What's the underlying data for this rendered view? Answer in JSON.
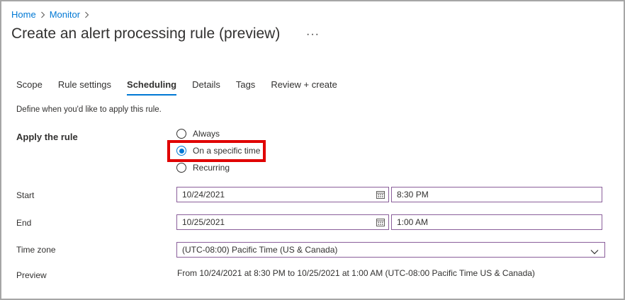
{
  "breadcrumb": {
    "items": [
      "Home",
      "Monitor"
    ]
  },
  "header": {
    "title": "Create an alert processing rule (preview)",
    "more_label": "···"
  },
  "tabs": [
    {
      "label": "Scope",
      "active": false
    },
    {
      "label": "Rule settings",
      "active": false
    },
    {
      "label": "Scheduling",
      "active": true
    },
    {
      "label": "Details",
      "active": false
    },
    {
      "label": "Tags",
      "active": false
    },
    {
      "label": "Review + create",
      "active": false
    }
  ],
  "scheduling": {
    "description": "Define when you'd like to apply this rule.",
    "apply_label": "Apply the rule",
    "options": [
      {
        "label": "Always",
        "checked": false
      },
      {
        "label": "On a specific time",
        "checked": true
      },
      {
        "label": "Recurring",
        "checked": false
      }
    ],
    "start": {
      "label": "Start",
      "date": "10/24/2021",
      "time": "8:30 PM"
    },
    "end": {
      "label": "End",
      "date": "10/25/2021",
      "time": "1:00 AM"
    },
    "timezone": {
      "label": "Time zone",
      "value": "(UTC-08:00) Pacific Time (US & Canada)"
    },
    "preview": {
      "label": "Preview",
      "text": "From 10/24/2021 at 8:30 PM to 10/25/2021 at 1:00 AM (UTC-08:00 Pacific Time US & Canada)"
    }
  },
  "colors": {
    "accent": "#0078d4",
    "highlight": "#e00000",
    "input_border": "#8a5e9a"
  }
}
